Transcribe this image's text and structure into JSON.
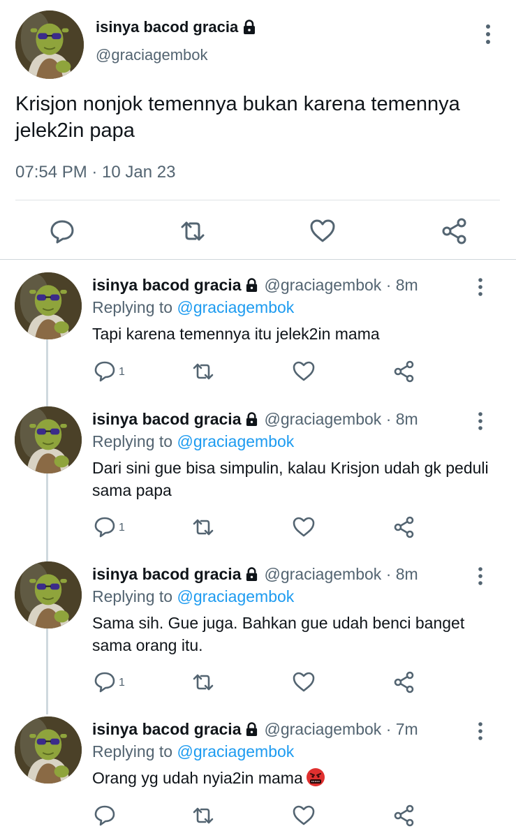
{
  "colors": {
    "text": "#0f1419",
    "secondary": "#536471",
    "link": "#1d9bf0",
    "divider": "#dfe3e6"
  },
  "main": {
    "name": "isinya bacod gracia",
    "handle": "@graciagembok",
    "text": "Krisjon nonjok temennya bukan karena temennya jelek2in papa",
    "timestamp": "07:54 PM · 10 Jan 23",
    "icons": [
      "reply-icon",
      "retweet-icon",
      "like-icon",
      "share-icon"
    ]
  },
  "replies": [
    {
      "name": "isinya bacod gracia",
      "handle": "@graciagembok · 8m",
      "replying_label": "Replying to ",
      "replying_to": "@graciagembok",
      "text": "Tapi karena temennya itu jelek2in mama",
      "reply_count": "1"
    },
    {
      "name": "isinya bacod gracia",
      "handle": "@graciagembok · 8m",
      "replying_label": "Replying to ",
      "replying_to": "@graciagembok",
      "text": "Dari sini gue bisa simpulin, kalau Krisjon udah gk peduli sama papa",
      "reply_count": "1"
    },
    {
      "name": "isinya bacod gracia",
      "handle": "@graciagembok · 8m",
      "replying_label": "Replying to ",
      "replying_to": "@graciagembok",
      "text": "Sama sih. Gue juga. Bahkan gue udah benci banget sama orang itu.",
      "reply_count": "1"
    },
    {
      "name": "isinya bacod gracia",
      "handle": "@graciagembok · 7m",
      "replying_label": "Replying to ",
      "replying_to": "@graciagembok",
      "text": "Orang yg udah nyia2in mama",
      "reply_count": "",
      "emoji": "face-with-symbols-on-mouth"
    }
  ]
}
